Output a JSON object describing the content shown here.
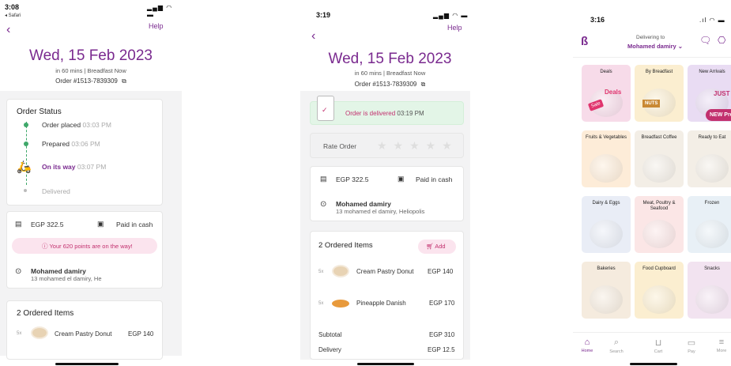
{
  "screen1": {
    "time": "3:08",
    "safari": "◂ Safari",
    "help": "Help",
    "date": "Wed, 15 Feb 2023",
    "eta": "in 60 mins | Breadfast Now",
    "order_no": "Order #1513-7839309",
    "status_title": "Order Status",
    "steps": [
      {
        "label": "Order placed",
        "time": "03:03 PM"
      },
      {
        "label": "Prepared",
        "time": "03:06 PM"
      },
      {
        "label": "On its way",
        "time": "03:07 PM"
      },
      {
        "label": "Delivered",
        "time": ""
      }
    ],
    "total": "EGP 322.5",
    "payment": "Paid in cash",
    "points": "Your 620 points are on the way!",
    "customer_name": "Mohamed damiry",
    "customer_address": "13 mohamed el damiry, He",
    "items_title": "2 Ordered Items",
    "items": [
      {
        "qty": "5x",
        "name": "Cream Pastry Donut",
        "price": "EGP 140"
      }
    ]
  },
  "screen2": {
    "time": "3:19",
    "help": "Help",
    "date": "Wed, 15 Feb 2023",
    "eta": "in 60 mins | Breadfast Now",
    "order_no": "Order #1513-7839309",
    "delivered_label": "Order is delivered",
    "delivered_time": "03:19 PM",
    "rate_label": "Rate Order",
    "total": "EGP 322.5",
    "payment": "Paid in cash",
    "customer_name": "Mohamed damiry",
    "customer_address": "13 mohamed el damiry, Heliopolis",
    "items_title": "2 Ordered Items",
    "add_label": "Add",
    "items": [
      {
        "qty": "5x",
        "name": "Cream Pastry Donut",
        "price": "EGP 140"
      },
      {
        "qty": "5x",
        "name": "Pineapple Danish",
        "price": "EGP 170"
      }
    ],
    "subtotal_label": "Subtotal",
    "subtotal_value": "EGP 310",
    "delivery_label": "Delivery",
    "delivery_value": "EGP 12.5"
  },
  "screen3": {
    "time": "3:16",
    "delivering_to": "Delivering to",
    "address_name": "Mohamed damiry",
    "tiles": [
      {
        "label": "Deals",
        "color": "#f7dbe9"
      },
      {
        "label": "By Breadfast",
        "color": "#fbeed0"
      },
      {
        "label": "New Arrivals",
        "color": "#e9dcf3"
      },
      {
        "label": "Fruits & Vegetables",
        "color": "#fdecd8"
      },
      {
        "label": "Breadfast Coffee",
        "color": "#f3eee6"
      },
      {
        "label": "Ready to Eat",
        "color": "#f3eee6"
      },
      {
        "label": "Dairy & Eggs",
        "color": "#e9edf6"
      },
      {
        "label": "Meat, Poultry & Seafood",
        "color": "#fbe6e6"
      },
      {
        "label": "Frozen",
        "color": "#e8f0f6"
      },
      {
        "label": "Bakeries",
        "color": "#f5ebde"
      },
      {
        "label": "Food Cupboard",
        "color": "#fbeed0"
      },
      {
        "label": "Snacks",
        "color": "#f2e3f0"
      }
    ],
    "tile_overlays": {
      "deals_word": "Deals",
      "sale": "Sale",
      "nuts": "NUTS",
      "just_in": "JUST IN",
      "new_products": "NEW Products"
    },
    "nav": [
      {
        "label": "Home",
        "icon": "home-icon"
      },
      {
        "label": "Search",
        "icon": "search-icon"
      },
      {
        "label": "Cart",
        "icon": "cart-icon"
      },
      {
        "label": "Pay",
        "icon": "pay-icon"
      },
      {
        "label": "More",
        "icon": "more-icon"
      }
    ]
  },
  "colors": {
    "brand": "#7a2a8f",
    "green": "#3fa86a",
    "pink": "#c2306e"
  }
}
